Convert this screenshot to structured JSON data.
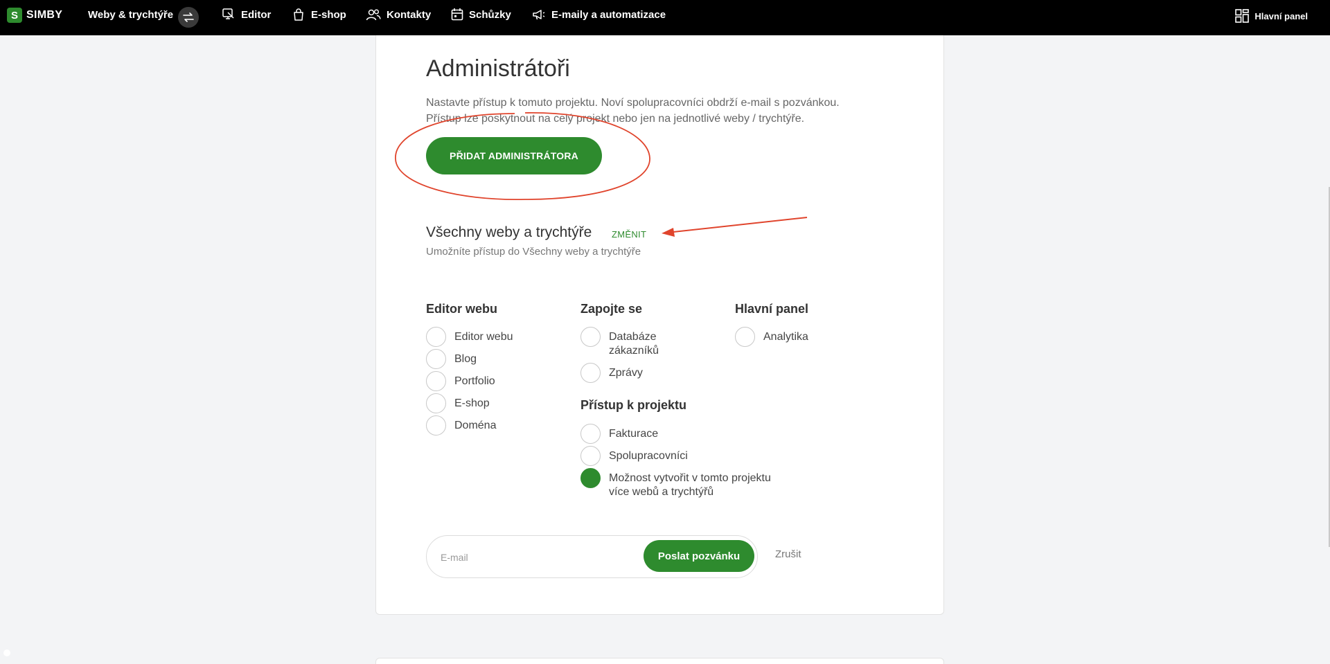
{
  "topbar": {
    "logo_letter": "S",
    "logo_text": "SIMBY",
    "project_name": "Weby & trychtýře",
    "nav": {
      "editor": "Editor",
      "eshop": "E-shop",
      "contacts": "Kontakty",
      "meetings": "Schůzky",
      "emails": "E-maily a automatizace"
    },
    "dashboard": "Hlavní panel",
    "icons": [
      "switch-icon",
      "editor-icon",
      "shopping-bag-icon",
      "contacts-icon",
      "calendar-icon",
      "megaphone-icon",
      "dashboard-icon"
    ]
  },
  "admins": {
    "title": "Administrátoři",
    "desc_line1": "Nastavte přístup k tomuto projektu. Noví spolupracovníci obdrží e-mail s pozvánkou.",
    "desc_line2": "Přístup lze poskytnout na celý projekt nebo jen na jednotlivé weby / trychtýře.",
    "add_button": "PŘIDAT ADMINISTRÁTORA"
  },
  "scope": {
    "title": "Všechny weby a trychtýře",
    "change": "ZMĚNIT",
    "desc": "Umožníte přístup do Všechny weby a trychtýře"
  },
  "permissions": {
    "web_editor": {
      "heading": "Editor webu",
      "options": [
        {
          "label": "Editor webu",
          "checked": false
        },
        {
          "label": "Blog",
          "checked": false
        },
        {
          "label": "Portfolio",
          "checked": false
        },
        {
          "label": "E-shop",
          "checked": false
        },
        {
          "label": "Doména",
          "checked": false
        }
      ]
    },
    "engage": {
      "heading": "Zapojte se",
      "options": [
        {
          "label_line1": "Databáze",
          "label_line2": "zákazníků",
          "checked": false
        },
        {
          "label": "Zprávy",
          "checked": false
        }
      ]
    },
    "dashboard": {
      "heading": "Hlavní panel",
      "options": [
        {
          "label": "Analytika",
          "checked": false
        }
      ]
    },
    "project_access": {
      "heading": "Přístup k projektu",
      "options": [
        {
          "label": "Fakturace",
          "checked": false
        },
        {
          "label": "Spolupracovníci",
          "checked": false
        },
        {
          "label_line1": "Možnost vytvořit v tomto projektu",
          "label_line2": "více webů a trychtýřů",
          "checked": true
        }
      ]
    }
  },
  "invite": {
    "email_placeholder": "E-mail",
    "send_button": "Poslat pozvánku",
    "cancel": "Zrušit"
  },
  "colors": {
    "accent": "#2e8b2e",
    "annotation": "#e0442c",
    "topbar": "#000000"
  }
}
